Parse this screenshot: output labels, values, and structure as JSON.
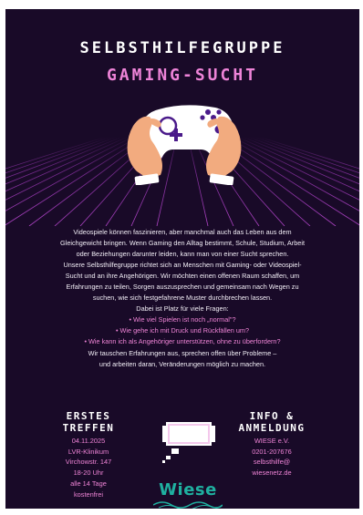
{
  "title": {
    "line1": "SELBSTHILFEGRUPPE",
    "line2": "GAMING-SUCHT"
  },
  "body": {
    "lines": [
      "Videospiele können faszinieren, aber manchmal auch das Leben aus dem",
      "Gleichgewicht bringen. Wenn Gaming den Alltag bestimmt, Schule, Studium, Arbeit",
      "oder Beziehungen darunter leiden, kann man von einer Sucht sprechen.",
      "Unsere Selbsthilfegruppe richtet sich an Menschen mit Gaming- oder Videospiel-",
      "Sucht und an ihre Angehörigen. Wir möchten einen offenen Raum schaffen, um",
      "Erfahrungen zu teilen, Sorgen auszusprechen und gemeinsam nach Wegen zu",
      "suchen, wie sich festgefahrene Muster durchbrechen lassen.",
      "Dabei ist Platz für viele Fragen:"
    ],
    "questions": [
      "• Wie viel Spielen ist noch „normal\"?",
      "• Wie gehe ich mit Druck und Rückfällen um?",
      "• Wie kann ich als Angehöriger unterstützen, ohne zu überfordern?"
    ],
    "closing": [
      "Wir tauschen Erfahrungen aus, sprechen offen über Probleme –",
      "und arbeiten daran, Veränderungen möglich zu machen."
    ]
  },
  "meeting": {
    "heading": [
      "ERSTES",
      "TREFFEN"
    ],
    "details": [
      "04.11.2025",
      "LVR-Klinikum",
      "Virchowstr. 147",
      "18-20 Uhr",
      "alle 14 Tage",
      "kostenfrei"
    ]
  },
  "contact": {
    "heading": [
      "INFO &",
      "ANMELDUNG"
    ],
    "details": [
      "WIESE e.V.",
      "0201-207676",
      "selbsthilfe@",
      "wiesenetz.de"
    ]
  },
  "logo": {
    "text": "Wiese"
  },
  "colors": {
    "background": "#190a28",
    "accent_pink": "#ef84d6",
    "grid": "#b23fd0",
    "logo": "#1fb0a0"
  },
  "icons": [
    "game-controller-icon",
    "speech-bubble-icon",
    "wiese-logo"
  ]
}
